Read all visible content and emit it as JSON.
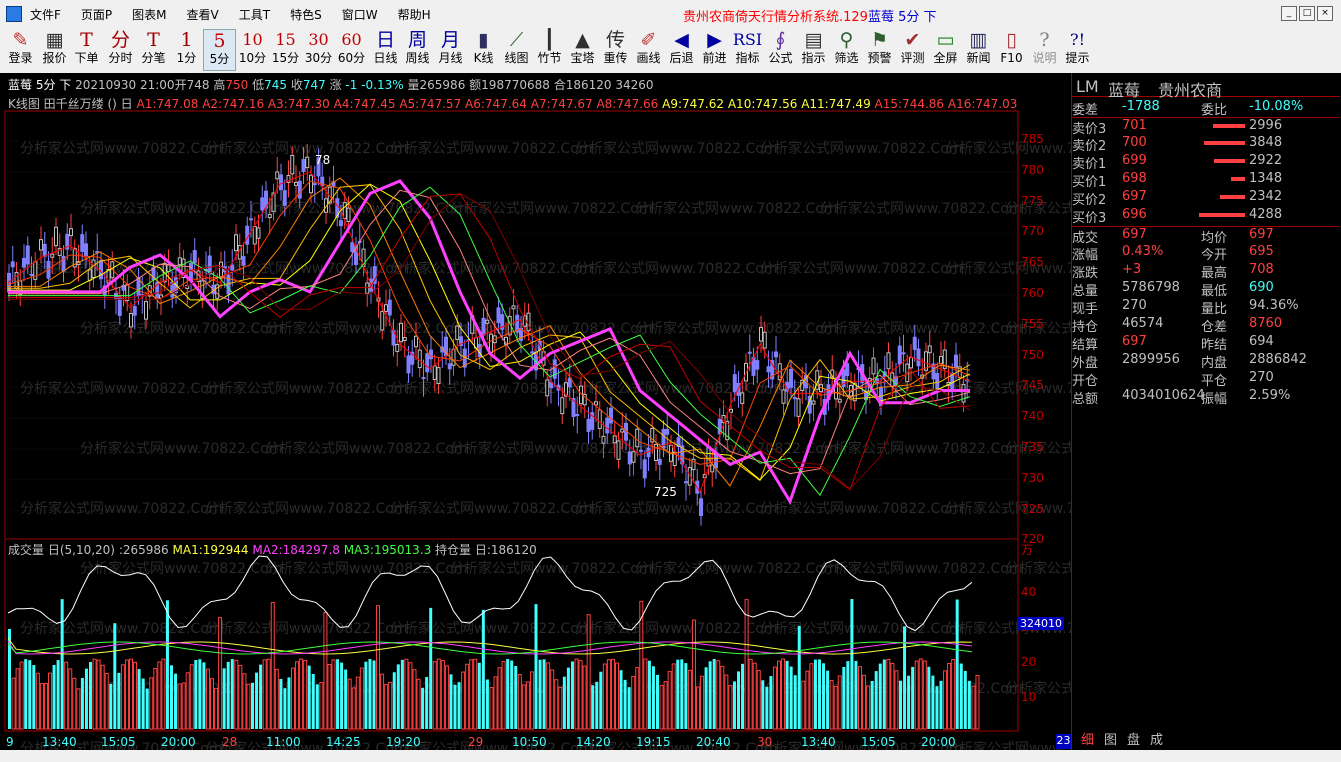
{
  "menu": [
    "文件F",
    "页面P",
    "图表M",
    "查看V",
    "工具T",
    "特色S",
    "窗口W",
    "帮助H"
  ],
  "window_title_red": "贵州农商倚天行情分析系统.129",
  "window_title_blue": "蓝莓 5分 下",
  "toolbar": [
    {
      "icon": "login-icon",
      "glyph": "✎",
      "label": "登录"
    },
    {
      "icon": "quote-icon",
      "glyph": "▦",
      "label": "报价"
    },
    {
      "icon": "order-icon",
      "glyph": "T",
      "label": "下单"
    },
    {
      "icon": "timeshare-icon",
      "glyph": "分",
      "label": "分时"
    },
    {
      "icon": "tick-icon",
      "glyph": "T",
      "label": "分笔"
    },
    {
      "icon": "period-1min-icon",
      "glyph": "1",
      "label": "1分"
    },
    {
      "icon": "period-5min-icon",
      "glyph": "5",
      "label": "5分"
    },
    {
      "icon": "period-10min-icon",
      "glyph": "10",
      "label": "10分"
    },
    {
      "icon": "period-15min-icon",
      "glyph": "15",
      "label": "15分"
    },
    {
      "icon": "period-30min-icon",
      "glyph": "30",
      "label": "30分"
    },
    {
      "icon": "period-60min-icon",
      "glyph": "60",
      "label": "60分"
    },
    {
      "icon": "daily-icon",
      "glyph": "日",
      "label": "日线"
    },
    {
      "icon": "weekly-icon",
      "glyph": "周",
      "label": "周线"
    },
    {
      "icon": "monthly-icon",
      "glyph": "月",
      "label": "月线"
    },
    {
      "icon": "kline-icon",
      "glyph": "▮",
      "label": "K线"
    },
    {
      "icon": "linechart-icon",
      "glyph": "⟋",
      "label": "线图"
    },
    {
      "icon": "bamboo-icon",
      "glyph": "┃",
      "label": "竹节"
    },
    {
      "icon": "tower-icon",
      "glyph": "▲",
      "label": "宝塔"
    },
    {
      "icon": "heavy-icon",
      "glyph": "传",
      "label": "重传"
    },
    {
      "icon": "draw-icon",
      "glyph": "✐",
      "label": "画线"
    },
    {
      "icon": "back-icon",
      "glyph": "◀",
      "label": "后退"
    },
    {
      "icon": "forward-icon",
      "glyph": "▶",
      "label": "前进"
    },
    {
      "icon": "indicator-icon",
      "glyph": "RSI",
      "label": "指标"
    },
    {
      "icon": "formula-icon",
      "glyph": "∮",
      "label": "公式"
    },
    {
      "icon": "guide-icon",
      "glyph": "▤",
      "label": "指示"
    },
    {
      "icon": "filter-icon",
      "glyph": "⚲",
      "label": "筛选"
    },
    {
      "icon": "alert-icon",
      "glyph": "⚑",
      "label": "预警"
    },
    {
      "icon": "evaluate-icon",
      "glyph": "✔",
      "label": "评测"
    },
    {
      "icon": "fullscreen-icon",
      "glyph": "▭",
      "label": "全屏"
    },
    {
      "icon": "news-icon",
      "glyph": "▥",
      "label": "新闻"
    },
    {
      "icon": "f10-icon",
      "glyph": "▯",
      "label": "F10"
    },
    {
      "icon": "manual-icon",
      "glyph": "?",
      "label": "说明"
    },
    {
      "icon": "hint-icon",
      "glyph": "?!",
      "label": "提示"
    }
  ],
  "info": {
    "name": "蓝莓 5分 下",
    "datetime": "20210930 21:00",
    "open_label": "开",
    "open": "748",
    "high_label": "高",
    "high": "750",
    "low_label": "低",
    "low": "745",
    "close_label": "收",
    "close": "747",
    "chg_label": "涨",
    "chg": "-1",
    "pct": "-0.13%",
    "vol_label": "量",
    "vol": "265986",
    "amt_label": "额",
    "amt": "198770688",
    "oi_label": "合",
    "oi": "186120 34260"
  },
  "indicator": {
    "head": "K线图 田千丝万缕 ()  日",
    "items": [
      {
        "t": "A1:747.08",
        "c": "#ff4040"
      },
      {
        "t": "A2:747.16",
        "c": "#ff4040"
      },
      {
        "t": "A3:747.30",
        "c": "#ff4040"
      },
      {
        "t": "A4:747.45",
        "c": "#ff4040"
      },
      {
        "t": "A5:747.57",
        "c": "#ff4040"
      },
      {
        "t": "A6:747.64",
        "c": "#ff4040"
      },
      {
        "t": "A7:747.67",
        "c": "#ff4040"
      },
      {
        "t": "A8:747.66",
        "c": "#ff4040"
      },
      {
        "t": "A9:747.62",
        "c": "#ffff40"
      },
      {
        "t": "A10:747.56",
        "c": "#ffff40"
      },
      {
        "t": "A11:747.49",
        "c": "#ffff40"
      },
      {
        "t": "A15:744.86",
        "c": "#ff4040"
      },
      {
        "t": "A16:747.03",
        "c": "#ff4040"
      }
    ]
  },
  "volume": {
    "head": "成交量 日(5,10,20)",
    "val": ":265986",
    "ma1": "MA1:192944",
    "ma2": "MA2:184297.8",
    "ma3": "MA3:195013.3",
    "oi": "持仓量 日:186120",
    "unit": "万",
    "marker": "324010"
  },
  "price_axis": [
    "785",
    "780",
    "775",
    "770",
    "765",
    "760",
    "755",
    "750",
    "745",
    "740",
    "735",
    "730",
    "725",
    "720"
  ],
  "vol_axis": [
    "40",
    "30",
    "20",
    "10"
  ],
  "annotations": {
    "high": "78",
    "low": "725"
  },
  "time_axis": [
    {
      "t": "9",
      "day": false
    },
    {
      "t": "13:40",
      "day": false
    },
    {
      "t": "15:05",
      "day": false
    },
    {
      "t": "20:00",
      "day": false
    },
    {
      "t": "28",
      "day": true
    },
    {
      "t": "11:00",
      "day": false
    },
    {
      "t": "14:25",
      "day": false
    },
    {
      "t": "19:20",
      "day": false
    },
    {
      "t": "29",
      "day": true
    },
    {
      "t": "10:50",
      "day": false
    },
    {
      "t": "14:20",
      "day": false
    },
    {
      "t": "19:15",
      "day": false
    },
    {
      "t": "20:40",
      "day": false
    },
    {
      "t": "30",
      "day": true
    },
    {
      "t": "13:40",
      "day": false
    },
    {
      "t": "15:05",
      "day": false
    },
    {
      "t": "20:00",
      "day": false
    }
  ],
  "corner_marker": "23",
  "panel": {
    "code": "LM",
    "name": "蓝莓",
    "exchange": "贵州农商",
    "rows": [
      {
        "k": "委差",
        "v": "-1788",
        "vc": "#40ffff",
        "k2": "委比",
        "v2": "-10.08%",
        "v2c": "#40ffff"
      },
      {
        "k": "卖价3",
        "v": "701",
        "vc": "#ff4040",
        "bar": 0.7,
        "q": "2996"
      },
      {
        "k": "卖价2",
        "v": "700",
        "vc": "#ff4040",
        "bar": 0.9,
        "q": "3848"
      },
      {
        "k": "卖价1",
        "v": "699",
        "vc": "#ff4040",
        "bar": 0.68,
        "q": "2922"
      },
      {
        "k": "买价1",
        "v": "698",
        "vc": "#ff4040",
        "bar": 0.31,
        "q": "1348"
      },
      {
        "k": "买价2",
        "v": "697",
        "vc": "#ff4040",
        "bar": 0.55,
        "q": "2342"
      },
      {
        "k": "买价3",
        "v": "696",
        "vc": "#ff4040",
        "bar": 1.0,
        "q": "4288"
      },
      {
        "k": "成交",
        "v": "697",
        "vc": "#ff4040",
        "k2": "均价",
        "v2": "697",
        "v2c": "#ff4040"
      },
      {
        "k": "涨幅",
        "v": "0.43%",
        "vc": "#ff4040",
        "k2": "今开",
        "v2": "695",
        "v2c": "#ff4040"
      },
      {
        "k": "涨跌",
        "v": "+3",
        "vc": "#ff4040",
        "k2": "最高",
        "v2": "708",
        "v2c": "#ff4040"
      },
      {
        "k": "总量",
        "v": "5786798",
        "vc": "#c0c0c0",
        "k2": "最低",
        "v2": "690",
        "v2c": "#40ffff"
      },
      {
        "k": "现手",
        "v": "270",
        "vc": "#c0c0c0",
        "k2": "量比",
        "v2": "94.36%",
        "v2c": "#c0c0c0"
      },
      {
        "k": "持仓",
        "v": "46574",
        "vc": "#c0c0c0",
        "k2": "仓差",
        "v2": "8760",
        "v2c": "#ff4040"
      },
      {
        "k": "结算",
        "v": "697",
        "vc": "#ff4040",
        "k2": "昨结",
        "v2": "694",
        "v2c": "#c0c0c0"
      },
      {
        "k": "外盘",
        "v": "2899956",
        "vc": "#c0c0c0",
        "k2": "内盘",
        "v2": "2886842",
        "v2c": "#c0c0c0"
      },
      {
        "k": "开仓",
        "v": "",
        "vc": "#c0c0c0",
        "k2": "平仓",
        "v2": "270",
        "v2c": "#c0c0c0"
      },
      {
        "k": "总额",
        "v": "4034010624",
        "vc": "#c0c0c0",
        "k2": "振幅",
        "v2": "2.59%",
        "v2c": "#c0c0c0"
      }
    ],
    "tabs": [
      "细",
      "图",
      "盘",
      "成"
    ]
  },
  "watermark": "分析家公式网www.70822.Com",
  "colors": {
    "up": "#ff4040",
    "down": "#40ffff",
    "grid": "#800000",
    "bg": "#000000"
  }
}
